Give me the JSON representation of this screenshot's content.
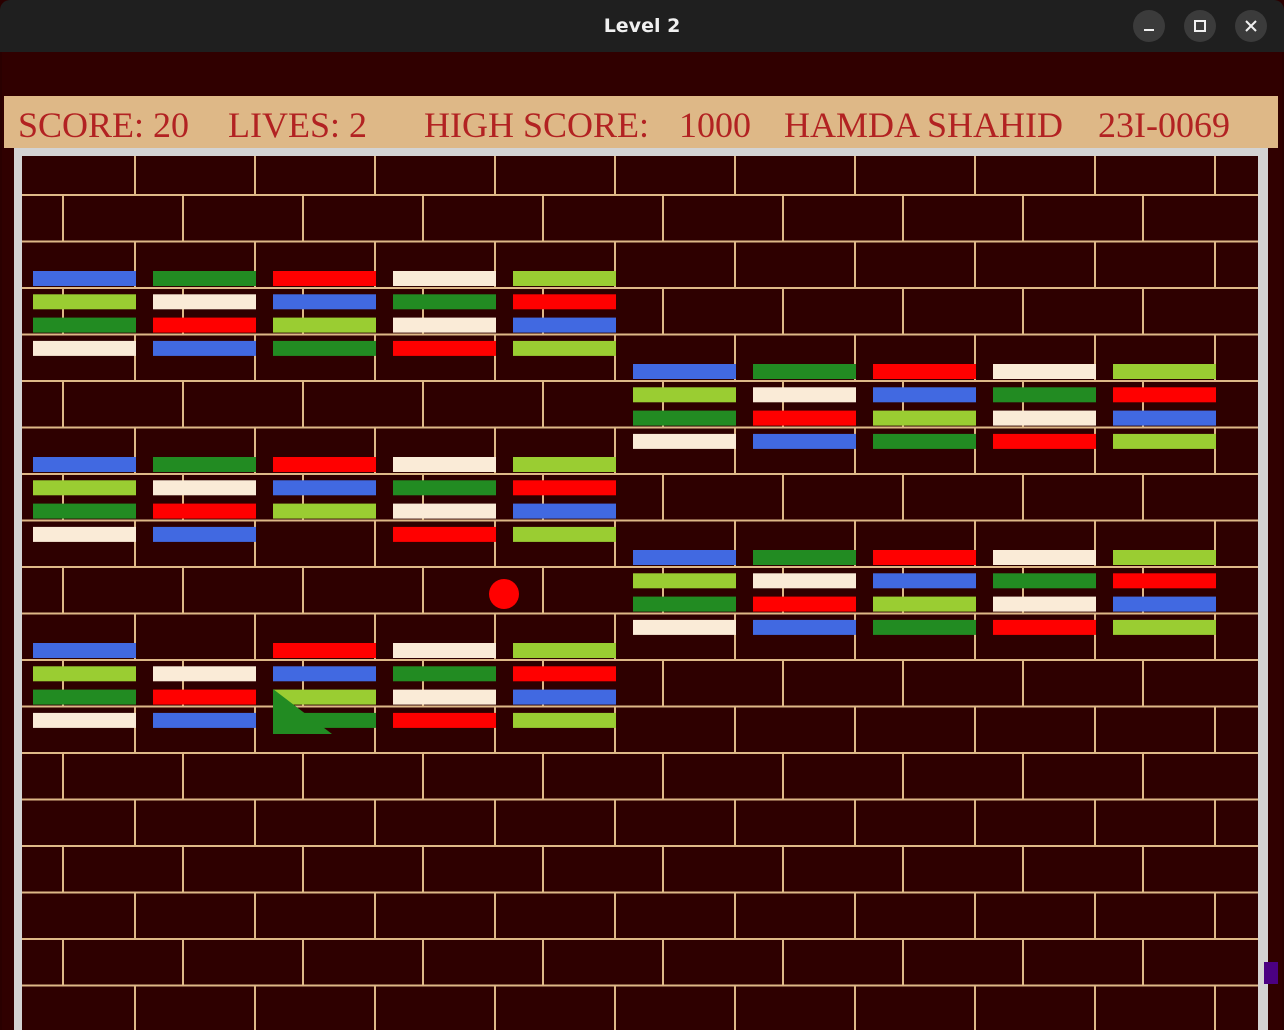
{
  "window": {
    "title": "Level 2",
    "controls": [
      "minimize-icon",
      "maximize-icon",
      "close-icon"
    ]
  },
  "hud": {
    "score": "SCORE: 20",
    "lives": "LIVES: 2",
    "high_score_label": "HIGH SCORE:",
    "high_score_value": "1000",
    "player_name": "HAMDA SHAHID",
    "player_id": "23I-0069"
  },
  "colors": {
    "background": "#300000",
    "mortar": "#deb887",
    "hud_bar": "#deb887",
    "hud_text": "#b22222",
    "frame": "#d3d3d3",
    "blue": "#4169e1",
    "lime": "#9acd32",
    "green": "#228b22",
    "cream": "#faebd7",
    "red": "#ff0000",
    "ball": "#ff0000",
    "powerup": "#228b22",
    "paddle": "#4b0082"
  },
  "bricks": {
    "clusters": [
      {
        "name": "cluster-top-left",
        "columns": [
          [
            "blue",
            "lime",
            "green",
            "cream"
          ],
          [
            "green",
            "cream",
            "red",
            "blue"
          ],
          [
            "red",
            "blue",
            "lime",
            "green"
          ],
          [
            "cream",
            "green",
            "cream",
            "red"
          ],
          [
            "lime",
            "red",
            "blue",
            "lime"
          ]
        ]
      },
      {
        "name": "cluster-top-right",
        "columns": [
          [
            "blue",
            "lime",
            "green",
            "cream"
          ],
          [
            "green",
            "cream",
            "red",
            "blue"
          ],
          [
            "red",
            "blue",
            "lime",
            "green"
          ],
          [
            "cream",
            "green",
            "cream",
            "red"
          ],
          [
            "lime",
            "red",
            "blue",
            "lime"
          ]
        ]
      },
      {
        "name": "cluster-middle-left",
        "columns": [
          [
            "blue",
            "lime",
            "green",
            "cream"
          ],
          [
            "green",
            "cream",
            "red",
            "blue"
          ],
          [
            "red",
            "blue",
            "lime",
            null
          ],
          [
            "cream",
            "green",
            "cream",
            "red"
          ],
          [
            "lime",
            "red",
            "blue",
            "lime"
          ]
        ]
      },
      {
        "name": "cluster-middle-right",
        "columns": [
          [
            "blue",
            "lime",
            "green",
            "cream"
          ],
          [
            "green",
            "cream",
            "red",
            "blue"
          ],
          [
            "red",
            "blue",
            "lime",
            "green"
          ],
          [
            "cream",
            "green",
            "cream",
            "red"
          ],
          [
            "lime",
            "red",
            "blue",
            "lime"
          ]
        ]
      },
      {
        "name": "cluster-bottom-left",
        "columns": [
          [
            "blue",
            "lime",
            "green",
            "cream"
          ],
          [
            null,
            "cream",
            "red",
            "blue"
          ],
          [
            "red",
            "blue",
            "lime",
            "green"
          ],
          [
            "cream",
            "green",
            "cream",
            "red"
          ],
          [
            "lime",
            "red",
            "blue",
            "lime"
          ]
        ]
      }
    ]
  },
  "ball": {
    "color": "red"
  },
  "powerup": {
    "icon": "triangle-powerup-icon",
    "color": "green"
  },
  "paddle": {
    "color": "purple"
  }
}
